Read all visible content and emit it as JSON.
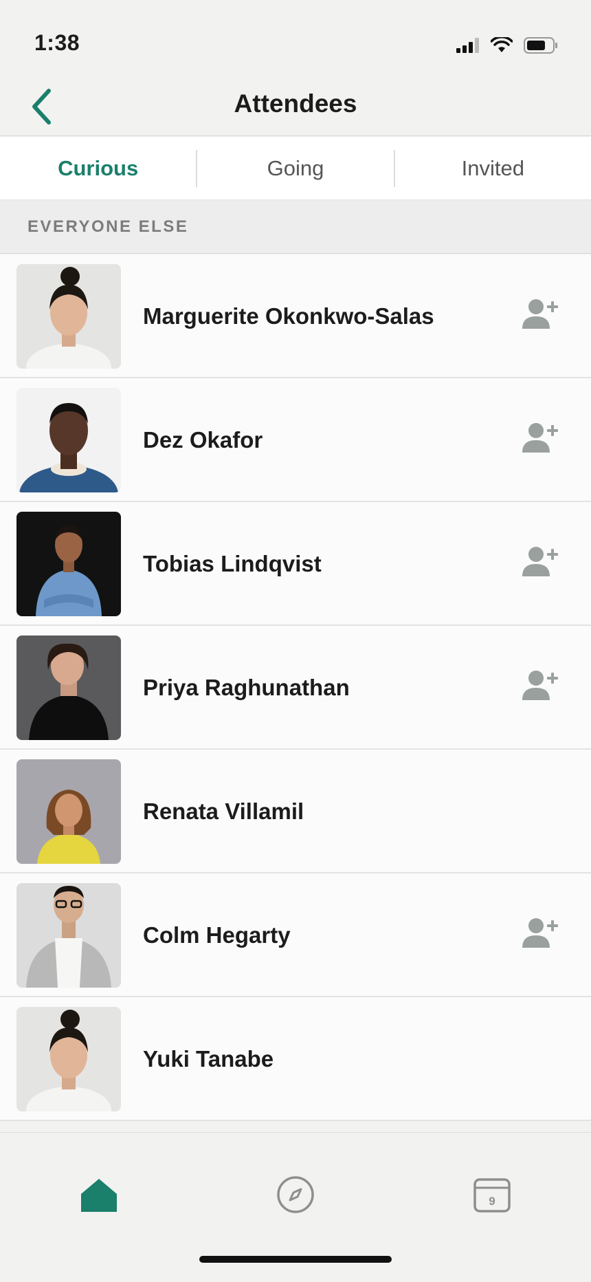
{
  "status": {
    "time": "1:38"
  },
  "nav": {
    "title": "Attendees"
  },
  "tabs": [
    {
      "label": "Curious",
      "active": true
    },
    {
      "label": "Going",
      "active": false
    },
    {
      "label": "Invited",
      "active": false
    }
  ],
  "section": {
    "title": "EVERYONE ELSE"
  },
  "attendees": [
    {
      "name": "Marguerite Okonkwo-Salas",
      "add": true
    },
    {
      "name": "Dez Okafor",
      "add": true
    },
    {
      "name": "Tobias Lindqvist",
      "add": true
    },
    {
      "name": "Priya Raghunathan",
      "add": true
    },
    {
      "name": "Renata Villamil",
      "add": false
    },
    {
      "name": "Colm Hegarty",
      "add": true
    },
    {
      "name": "Yuki Tanabe",
      "add": false
    }
  ],
  "tabbar": {
    "calendar_day": "9"
  },
  "colors": {
    "accent": "#1a7f6b",
    "icon_gray": "#9aa09e"
  }
}
